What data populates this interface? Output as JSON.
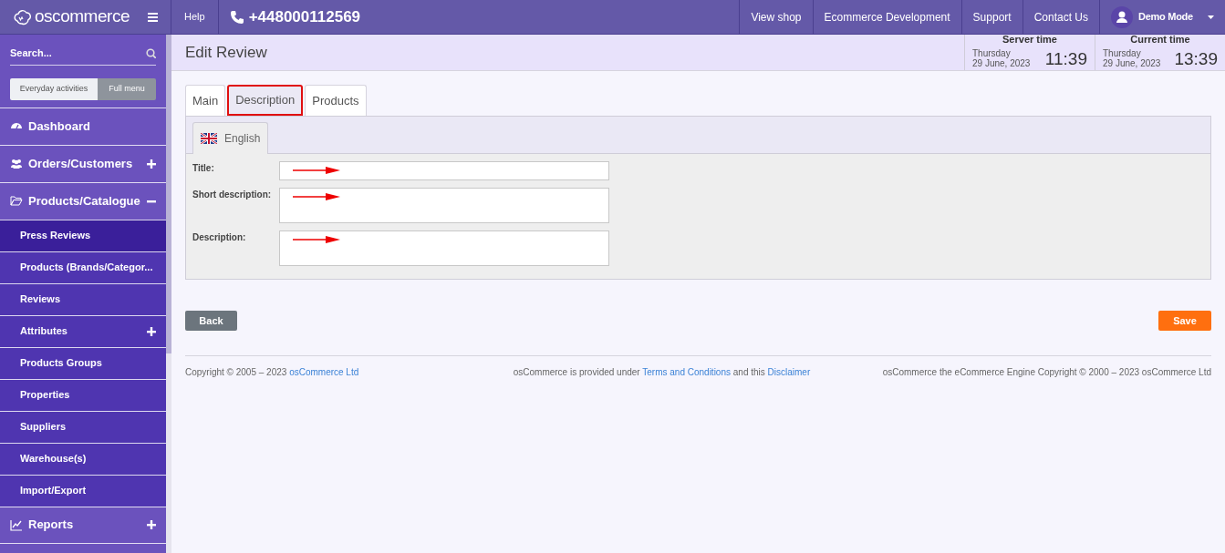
{
  "topbar": {
    "logo": "oscommerce",
    "help": "Help",
    "phone": "+448000112569",
    "menu": [
      "View shop",
      "Ecommerce Development",
      "Support",
      "Contact Us"
    ],
    "user": "Demo Mode"
  },
  "sidebar": {
    "search_placeholder": "Search...",
    "modes": [
      {
        "label": "Everyday activities",
        "selected": false
      },
      {
        "label": "Full menu",
        "selected": true
      }
    ],
    "items": [
      {
        "kind": "section",
        "label": "Dashboard",
        "selected": false
      },
      {
        "kind": "section",
        "label": "Orders/Customers",
        "expanded": false,
        "selected": false
      },
      {
        "kind": "section",
        "label": "Products/Catalogue",
        "expanded": true,
        "selected": false,
        "children": [
          {
            "label": "Press Reviews",
            "selected": true
          },
          {
            "label": "Products (Brands/Categor...",
            "selected": false
          },
          {
            "label": "Reviews",
            "selected": false
          },
          {
            "label": "Attributes",
            "expanded": false,
            "selected": false
          },
          {
            "label": "Products Groups",
            "selected": false
          },
          {
            "label": "Properties",
            "selected": false
          },
          {
            "label": "Suppliers",
            "selected": false
          },
          {
            "label": "Warehouse(s)",
            "selected": false
          },
          {
            "label": "Import/Export",
            "selected": false
          }
        ]
      },
      {
        "kind": "section",
        "label": "Reports",
        "expanded": false,
        "selected": false
      }
    ]
  },
  "page": {
    "title": "Edit Review"
  },
  "clocks": [
    {
      "label": "Server time",
      "day": "Thursday",
      "date": "29 June, 2023",
      "time": "11:39"
    },
    {
      "label": "Current time",
      "day": "Thursday",
      "date": "29 June, 2023",
      "time": "13:39"
    }
  ],
  "tabs": [
    {
      "label": "Main",
      "selected": false,
      "highlighted": false
    },
    {
      "label": "Description",
      "selected": true,
      "highlighted": true
    },
    {
      "label": "Products",
      "selected": false,
      "highlighted": false
    }
  ],
  "language_tabs": [
    {
      "label": "English",
      "selected": true
    }
  ],
  "fields": [
    {
      "label": "Title:",
      "kind": "input",
      "arrow": true
    },
    {
      "label": "Short description:",
      "kind": "textarea",
      "arrow": true
    },
    {
      "label": "Description:",
      "kind": "textarea",
      "arrow": true
    }
  ],
  "buttons": {
    "back": "Back",
    "save": "Save"
  },
  "footer": [
    [
      {
        "text": "Copyright © 2005 – 2023 ",
        "link": false
      },
      {
        "text": "osCommerce Ltd",
        "link": true
      }
    ],
    [
      {
        "text": "osCommerce is provided under ",
        "link": false
      },
      {
        "text": "Terms and Conditions",
        "link": true
      },
      {
        "text": " and this ",
        "link": false
      },
      {
        "text": "Disclaimer",
        "link": true
      }
    ],
    [
      {
        "text": "osCommerce the eCommerce Engine Copyright © 2000 – 2023 osCommerce Ltd",
        "link": false
      }
    ]
  ]
}
